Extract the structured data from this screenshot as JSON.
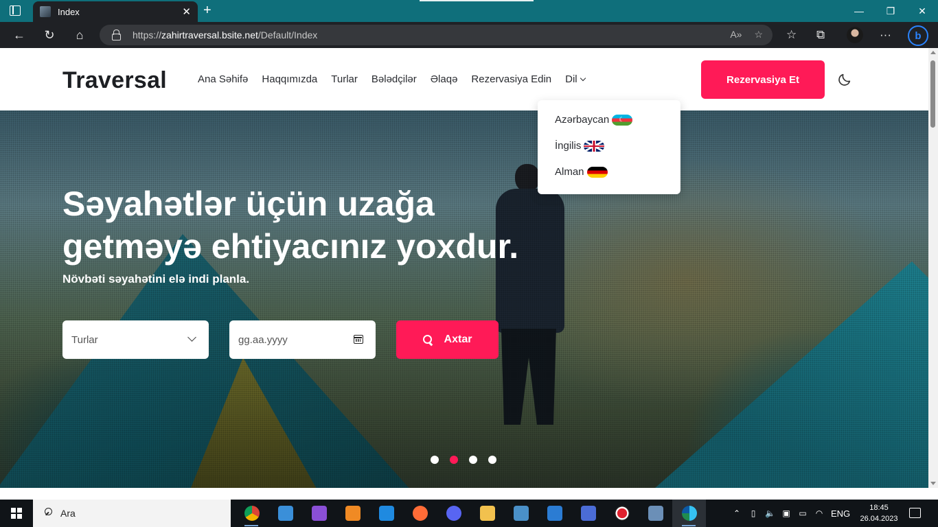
{
  "browser": {
    "tab_title": "Index",
    "url_scheme": "https://",
    "url_host": "zahirtraversal.bsite.net",
    "url_path": "/Default/Index"
  },
  "site": {
    "logo": "Traversal",
    "nav": [
      "Ana Səhifə",
      "Haqqımızda",
      "Turlar",
      "Bələdçilər",
      "Əlaqə",
      "Rezervasiya Edin",
      "Dil"
    ],
    "cta": "Rezervasiya Et",
    "theme_toggle_icon": "moon-icon",
    "accent_color": "#ff1a57"
  },
  "language_menu": [
    {
      "label": "Azərbaycan",
      "flag": "azerbaijan-flag"
    },
    {
      "label": "İngilis",
      "flag": "uk-flag"
    },
    {
      "label": "Alman",
      "flag": "germany-flag"
    }
  ],
  "hero": {
    "title_line1": "Səyahətlər üçün uzağa",
    "title_line2": "getməyə ehtiyacınız yoxdur.",
    "subtitle": "Növbəti səyahətini elə indi planla.",
    "tours_select": "Turlar",
    "date_placeholder": "gg.aa.yyyy",
    "search_button": "Axtar",
    "slides": 4,
    "active_slide": 2
  },
  "taskbar": {
    "search_label": "Ara",
    "language": "ENG",
    "time": "18:45",
    "date": "26.04.2023"
  }
}
